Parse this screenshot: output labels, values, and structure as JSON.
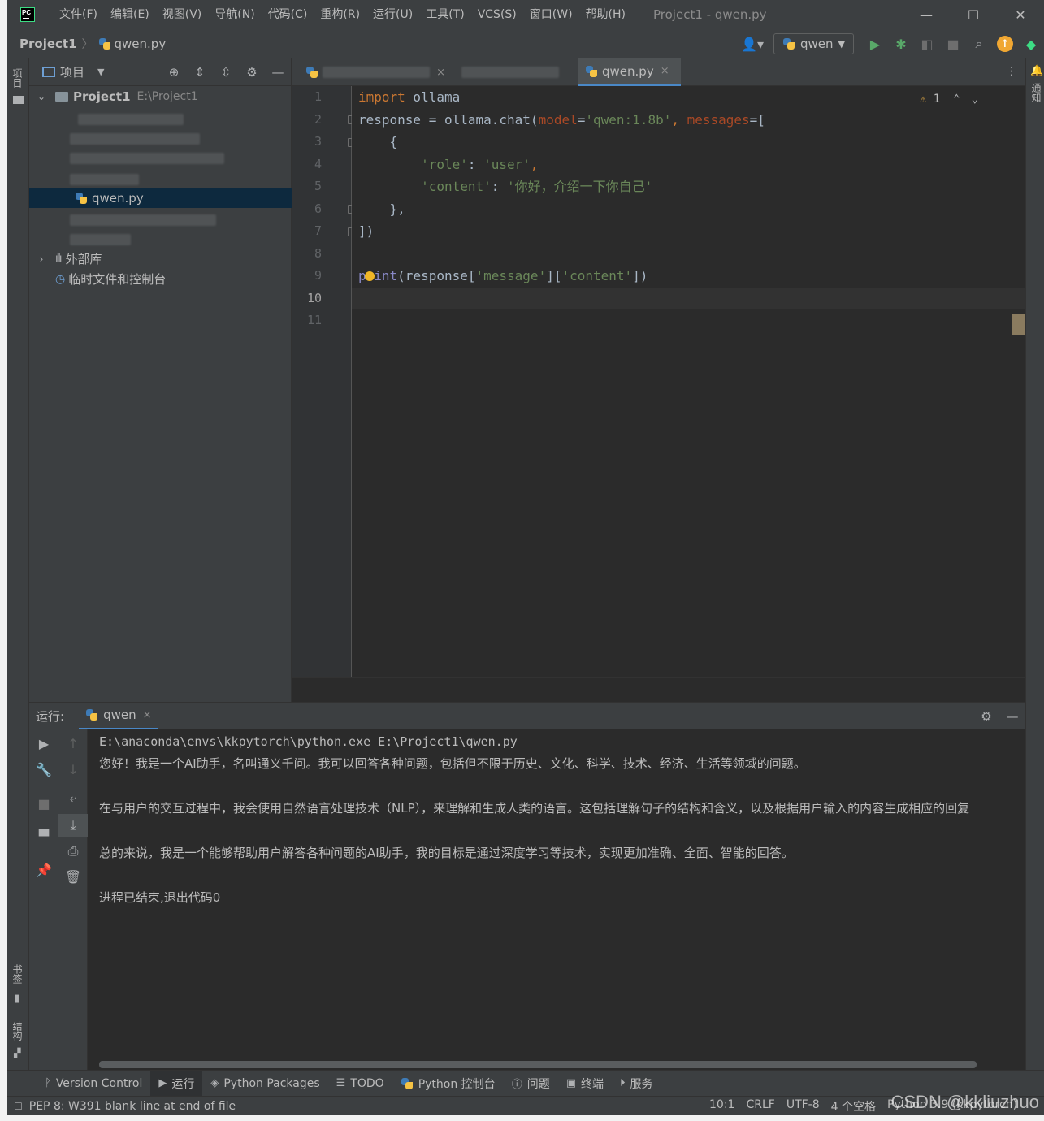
{
  "titlebar": {
    "menus": [
      "文件(F)",
      "编辑(E)",
      "视图(V)",
      "导航(N)",
      "代码(C)",
      "重构(R)",
      "运行(U)",
      "工具(T)",
      "VCS(S)",
      "窗口(W)",
      "帮助(H)"
    ],
    "window_title": "Project1 - qwen.py"
  },
  "navbar": {
    "project": "Project1",
    "file": "qwen.py",
    "run_config": "qwen"
  },
  "left_stripe": {
    "project_tab": "项目",
    "bookmarks_tab": "书签",
    "structure_tab": "结构"
  },
  "right_stripe": {
    "notifications_tab": "通知"
  },
  "project_panel": {
    "title": "项目",
    "root_name": "Project1",
    "root_path": "E:\\Project1",
    "selected_file": "qwen.py",
    "external_libs": "外部库",
    "scratches": "临时文件和控制台"
  },
  "editor": {
    "active_tab": "qwen.py",
    "warning_count": "1",
    "line_numbers": [
      "1",
      "2",
      "3",
      "4",
      "5",
      "6",
      "7",
      "8",
      "9",
      "10",
      "11"
    ],
    "code": {
      "l1_kw": "import",
      "l1_mod": " ollama",
      "l2_a": "response = ollama.chat(",
      "l2_p1": "model",
      "l2_eq1": "=",
      "l2_s1": "'qwen:1.8b'",
      "l2_comma": ", ",
      "l2_p2": "messages",
      "l2_end": "=[",
      "l3": "    {",
      "l4_s1": "'role'",
      "l4_colon": ": ",
      "l4_s2": "'user'",
      "l4_end": ",",
      "l5_s1": "'content'",
      "l5_colon": ": ",
      "l5_s2": "'你好，介绍一下你自己'",
      "l6": "    },",
      "l7": "])",
      "l9_fn": "print",
      "l9_a": "(response[",
      "l9_s1": "'message'",
      "l9_b": "][",
      "l9_s2": "'content'",
      "l9_c": "])"
    }
  },
  "run_panel": {
    "label": "运行:",
    "tab": "qwen",
    "lines": [
      "E:\\anaconda\\envs\\kkpytorch\\python.exe E:\\Project1\\qwen.py",
      "您好！我是一个AI助手，名叫通义千问。我可以回答各种问题，包括但不限于历史、文化、科学、技术、经济、生活等领域的问题。",
      "在与用户的交互过程中，我会使用自然语言处理技术（NLP），来理解和生成人类的语言。这包括理解句子的结构和含义，以及根据用户输入的内容生成相应的回复",
      "总的来说，我是一个能够帮助用户解答各种问题的AI助手，我的目标是通过深度学习等技术，实现更加准确、全面、智能的回答。",
      "进程已结束,退出代码0"
    ]
  },
  "tool_windows": [
    "Version Control",
    "运行",
    "Python Packages",
    "TODO",
    "Python 控制台",
    "问题",
    "终端",
    "服务"
  ],
  "status_bar": {
    "message": "PEP 8: W391 blank line at end of file",
    "position": "10:1",
    "line_sep": "CRLF",
    "encoding": "UTF-8",
    "indent": "4 个空格",
    "interpreter": "Python 3.9 (kkpytorch)"
  },
  "watermark": "CSDN @kkliuzhuo"
}
